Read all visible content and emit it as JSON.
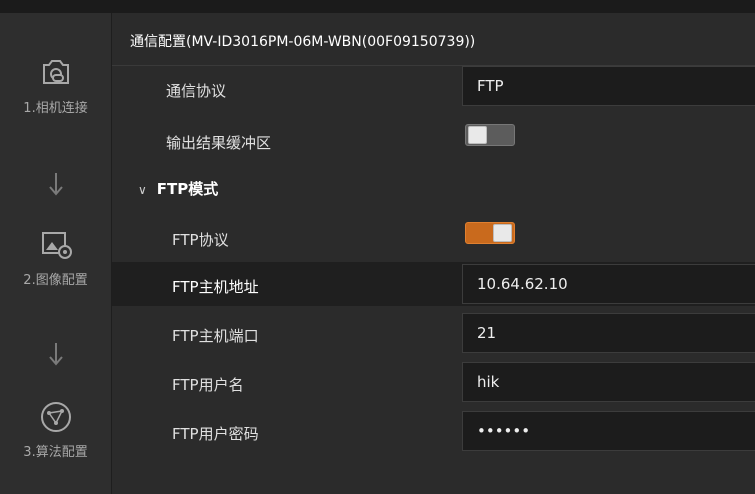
{
  "sidebar": {
    "steps": [
      {
        "label": "1.相机连接",
        "icon": "camera-link-icon"
      },
      {
        "label": "2.图像配置",
        "icon": "image-settings-icon"
      },
      {
        "label": "3.算法配置",
        "icon": "algorithm-icon"
      }
    ]
  },
  "header": {
    "title": "通信配置(MV-ID3016PM-06M-WBN(00F09150739))"
  },
  "form": {
    "protocol": {
      "label": "通信协议",
      "value": "FTP"
    },
    "output_buffer": {
      "label": "输出结果缓冲区",
      "enabled": false
    },
    "section_ftp": {
      "label": "FTP模式",
      "expanded": true
    },
    "ftp_protocol": {
      "label": "FTP协议",
      "enabled": true
    },
    "ftp_host": {
      "label": "FTP主机地址",
      "value": "10.64.62.10"
    },
    "ftp_port": {
      "label": "FTP主机端口",
      "value": "21"
    },
    "ftp_user": {
      "label": "FTP用户名",
      "value": "hik"
    },
    "ftp_password": {
      "label": "FTP用户密码",
      "value": "••••••"
    }
  },
  "colors": {
    "accent": "#c96a1d",
    "background": "#2b2b2b",
    "field": "#1c1c1c"
  }
}
